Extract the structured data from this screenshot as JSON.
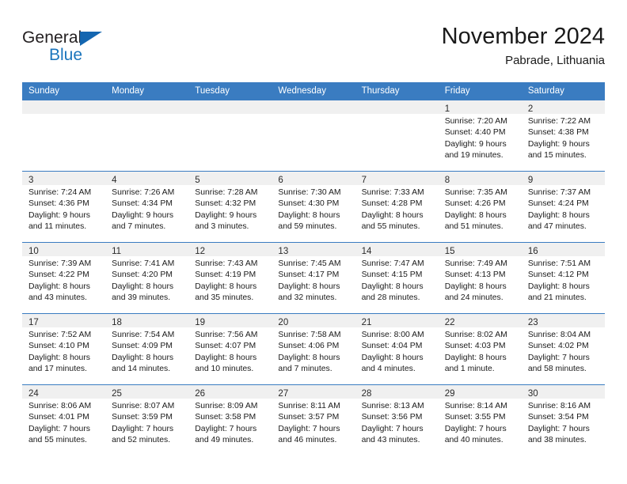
{
  "brand": {
    "name_part1": "General",
    "name_part2": "Blue",
    "accent_color": "#1b75bc",
    "triangle_color": "#1466b0"
  },
  "header": {
    "title": "November 2024",
    "subtitle": "Pabrade, Lithuania"
  },
  "theme": {
    "header_row_bg": "#3a7cc1",
    "daynum_band_bg": "#f0f0f0",
    "grid_line": "#3a7cc1",
    "text": "#1a1a1a"
  },
  "labels": {
    "sunrise_prefix": "Sunrise:",
    "sunset_prefix": "Sunset:",
    "daylight_prefix": "Daylight:"
  },
  "weekday_headers": [
    "Sunday",
    "Monday",
    "Tuesday",
    "Wednesday",
    "Thursday",
    "Friday",
    "Saturday"
  ],
  "weeks": [
    [
      {
        "day": "",
        "empty": true
      },
      {
        "day": "",
        "empty": true
      },
      {
        "day": "",
        "empty": true
      },
      {
        "day": "",
        "empty": true
      },
      {
        "day": "",
        "empty": true
      },
      {
        "day": "1",
        "sunrise": "Sunrise: 7:20 AM",
        "sunset": "Sunset: 4:40 PM",
        "daylight_line1": "Daylight: 9 hours",
        "daylight_line2": "and 19 minutes."
      },
      {
        "day": "2",
        "sunrise": "Sunrise: 7:22 AM",
        "sunset": "Sunset: 4:38 PM",
        "daylight_line1": "Daylight: 9 hours",
        "daylight_line2": "and 15 minutes."
      }
    ],
    [
      {
        "day": "3",
        "sunrise": "Sunrise: 7:24 AM",
        "sunset": "Sunset: 4:36 PM",
        "daylight_line1": "Daylight: 9 hours",
        "daylight_line2": "and 11 minutes."
      },
      {
        "day": "4",
        "sunrise": "Sunrise: 7:26 AM",
        "sunset": "Sunset: 4:34 PM",
        "daylight_line1": "Daylight: 9 hours",
        "daylight_line2": "and 7 minutes."
      },
      {
        "day": "5",
        "sunrise": "Sunrise: 7:28 AM",
        "sunset": "Sunset: 4:32 PM",
        "daylight_line1": "Daylight: 9 hours",
        "daylight_line2": "and 3 minutes."
      },
      {
        "day": "6",
        "sunrise": "Sunrise: 7:30 AM",
        "sunset": "Sunset: 4:30 PM",
        "daylight_line1": "Daylight: 8 hours",
        "daylight_line2": "and 59 minutes."
      },
      {
        "day": "7",
        "sunrise": "Sunrise: 7:33 AM",
        "sunset": "Sunset: 4:28 PM",
        "daylight_line1": "Daylight: 8 hours",
        "daylight_line2": "and 55 minutes."
      },
      {
        "day": "8",
        "sunrise": "Sunrise: 7:35 AM",
        "sunset": "Sunset: 4:26 PM",
        "daylight_line1": "Daylight: 8 hours",
        "daylight_line2": "and 51 minutes."
      },
      {
        "day": "9",
        "sunrise": "Sunrise: 7:37 AM",
        "sunset": "Sunset: 4:24 PM",
        "daylight_line1": "Daylight: 8 hours",
        "daylight_line2": "and 47 minutes."
      }
    ],
    [
      {
        "day": "10",
        "sunrise": "Sunrise: 7:39 AM",
        "sunset": "Sunset: 4:22 PM",
        "daylight_line1": "Daylight: 8 hours",
        "daylight_line2": "and 43 minutes."
      },
      {
        "day": "11",
        "sunrise": "Sunrise: 7:41 AM",
        "sunset": "Sunset: 4:20 PM",
        "daylight_line1": "Daylight: 8 hours",
        "daylight_line2": "and 39 minutes."
      },
      {
        "day": "12",
        "sunrise": "Sunrise: 7:43 AM",
        "sunset": "Sunset: 4:19 PM",
        "daylight_line1": "Daylight: 8 hours",
        "daylight_line2": "and 35 minutes."
      },
      {
        "day": "13",
        "sunrise": "Sunrise: 7:45 AM",
        "sunset": "Sunset: 4:17 PM",
        "daylight_line1": "Daylight: 8 hours",
        "daylight_line2": "and 32 minutes."
      },
      {
        "day": "14",
        "sunrise": "Sunrise: 7:47 AM",
        "sunset": "Sunset: 4:15 PM",
        "daylight_line1": "Daylight: 8 hours",
        "daylight_line2": "and 28 minutes."
      },
      {
        "day": "15",
        "sunrise": "Sunrise: 7:49 AM",
        "sunset": "Sunset: 4:13 PM",
        "daylight_line1": "Daylight: 8 hours",
        "daylight_line2": "and 24 minutes."
      },
      {
        "day": "16",
        "sunrise": "Sunrise: 7:51 AM",
        "sunset": "Sunset: 4:12 PM",
        "daylight_line1": "Daylight: 8 hours",
        "daylight_line2": "and 21 minutes."
      }
    ],
    [
      {
        "day": "17",
        "sunrise": "Sunrise: 7:52 AM",
        "sunset": "Sunset: 4:10 PM",
        "daylight_line1": "Daylight: 8 hours",
        "daylight_line2": "and 17 minutes."
      },
      {
        "day": "18",
        "sunrise": "Sunrise: 7:54 AM",
        "sunset": "Sunset: 4:09 PM",
        "daylight_line1": "Daylight: 8 hours",
        "daylight_line2": "and 14 minutes."
      },
      {
        "day": "19",
        "sunrise": "Sunrise: 7:56 AM",
        "sunset": "Sunset: 4:07 PM",
        "daylight_line1": "Daylight: 8 hours",
        "daylight_line2": "and 10 minutes."
      },
      {
        "day": "20",
        "sunrise": "Sunrise: 7:58 AM",
        "sunset": "Sunset: 4:06 PM",
        "daylight_line1": "Daylight: 8 hours",
        "daylight_line2": "and 7 minutes."
      },
      {
        "day": "21",
        "sunrise": "Sunrise: 8:00 AM",
        "sunset": "Sunset: 4:04 PM",
        "daylight_line1": "Daylight: 8 hours",
        "daylight_line2": "and 4 minutes."
      },
      {
        "day": "22",
        "sunrise": "Sunrise: 8:02 AM",
        "sunset": "Sunset: 4:03 PM",
        "daylight_line1": "Daylight: 8 hours",
        "daylight_line2": "and 1 minute."
      },
      {
        "day": "23",
        "sunrise": "Sunrise: 8:04 AM",
        "sunset": "Sunset: 4:02 PM",
        "daylight_line1": "Daylight: 7 hours",
        "daylight_line2": "and 58 minutes."
      }
    ],
    [
      {
        "day": "24",
        "sunrise": "Sunrise: 8:06 AM",
        "sunset": "Sunset: 4:01 PM",
        "daylight_line1": "Daylight: 7 hours",
        "daylight_line2": "and 55 minutes."
      },
      {
        "day": "25",
        "sunrise": "Sunrise: 8:07 AM",
        "sunset": "Sunset: 3:59 PM",
        "daylight_line1": "Daylight: 7 hours",
        "daylight_line2": "and 52 minutes."
      },
      {
        "day": "26",
        "sunrise": "Sunrise: 8:09 AM",
        "sunset": "Sunset: 3:58 PM",
        "daylight_line1": "Daylight: 7 hours",
        "daylight_line2": "and 49 minutes."
      },
      {
        "day": "27",
        "sunrise": "Sunrise: 8:11 AM",
        "sunset": "Sunset: 3:57 PM",
        "daylight_line1": "Daylight: 7 hours",
        "daylight_line2": "and 46 minutes."
      },
      {
        "day": "28",
        "sunrise": "Sunrise: 8:13 AM",
        "sunset": "Sunset: 3:56 PM",
        "daylight_line1": "Daylight: 7 hours",
        "daylight_line2": "and 43 minutes."
      },
      {
        "day": "29",
        "sunrise": "Sunrise: 8:14 AM",
        "sunset": "Sunset: 3:55 PM",
        "daylight_line1": "Daylight: 7 hours",
        "daylight_line2": "and 40 minutes."
      },
      {
        "day": "30",
        "sunrise": "Sunrise: 8:16 AM",
        "sunset": "Sunset: 3:54 PM",
        "daylight_line1": "Daylight: 7 hours",
        "daylight_line2": "and 38 minutes."
      }
    ]
  ]
}
